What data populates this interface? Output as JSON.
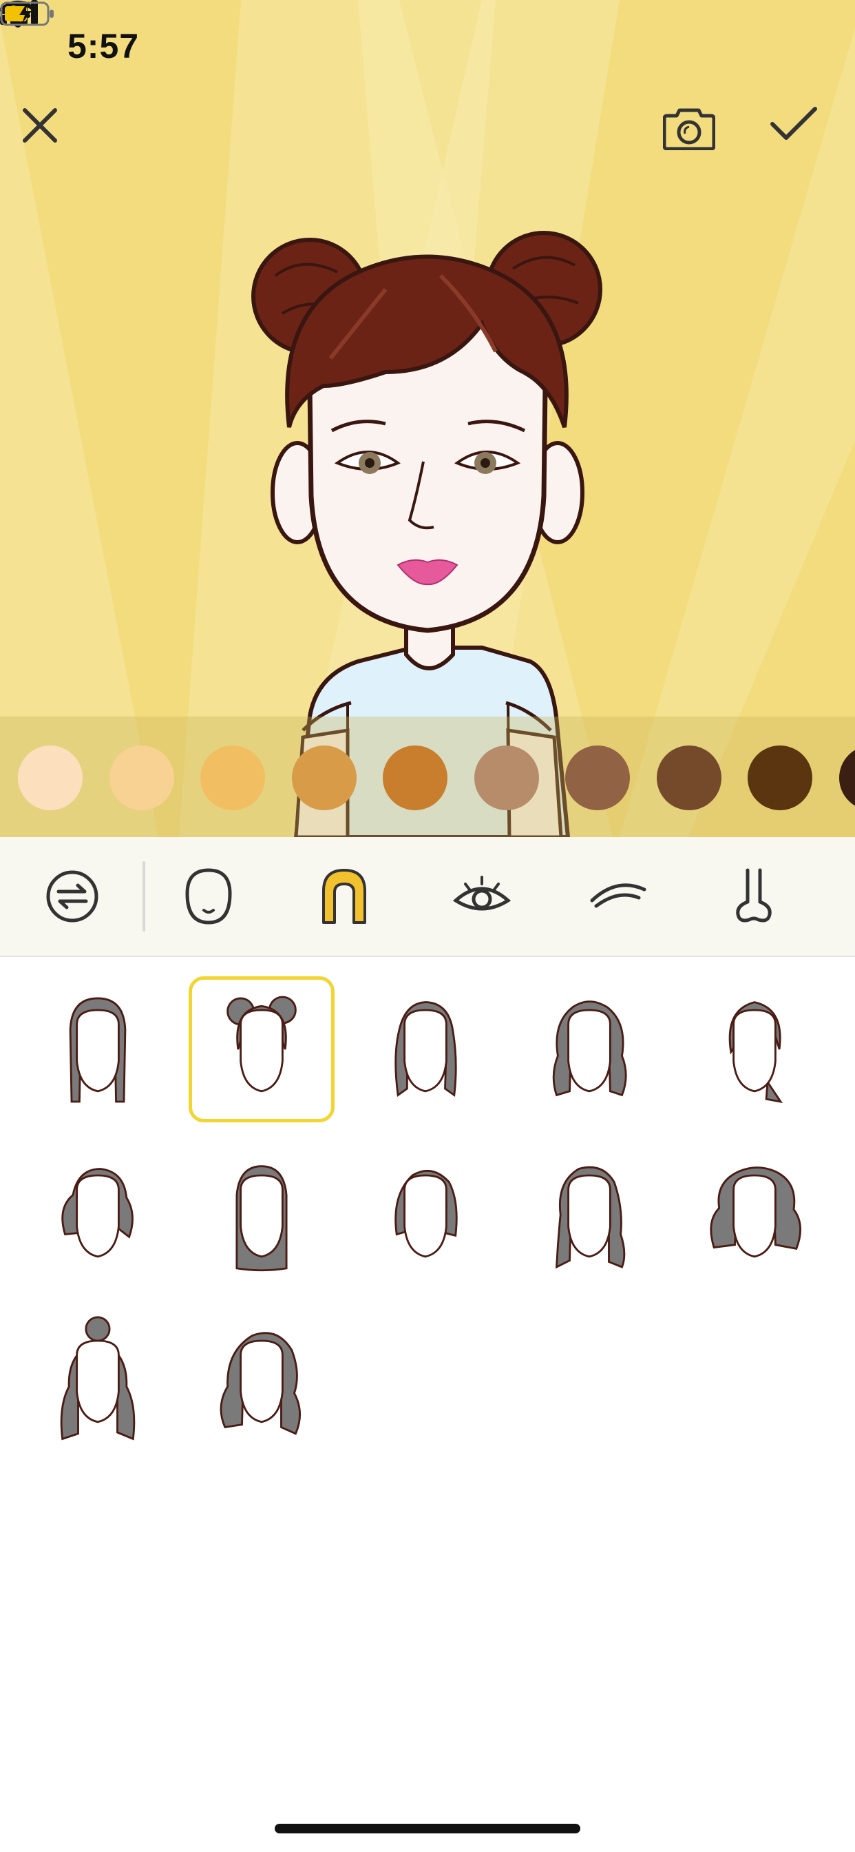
{
  "status_bar": {
    "time": "5:57"
  },
  "icons": {
    "location": "location-arrow-icon",
    "signal": "cellular-signal-icon",
    "wifi": "wifi-icon",
    "battery": "battery-charging-icon",
    "close": "close-icon",
    "camera": "camera-icon",
    "confirm": "checkmark-icon"
  },
  "colors": {
    "stage_background": "#f5e38f",
    "selection_accent": "#f2d531",
    "active_tool": "#f2c12e",
    "hair_thumb": "#7a7a7a",
    "avatar_hair": "#6b2315",
    "avatar_skin": "#fbf3ef",
    "avatar_shirt": "#dff1fb"
  },
  "skin_tones": [
    "#fce0bd",
    "#f8d292",
    "#f1be62",
    "#d89b48",
    "#c87e2c",
    "#b78c6a",
    "#916244",
    "#744a2b",
    "#5a3510",
    "#3a1f12"
  ],
  "toolbar": {
    "tools": [
      {
        "name": "swap-icon",
        "active": false
      },
      {
        "name": "face-shape-icon",
        "active": false
      },
      {
        "name": "hair-icon",
        "active": true
      },
      {
        "name": "eye-icon",
        "active": false
      },
      {
        "name": "eyebrow-icon",
        "active": false
      },
      {
        "name": "nose-icon",
        "active": false
      }
    ]
  },
  "hair_styles": {
    "selected_index": 1,
    "items": [
      "straight-long-hair",
      "double-buns-hair",
      "shoulder-bob-hair",
      "wavy-long-hair",
      "short-side-swept-hair",
      "curly-short-hair",
      "sleek-straight-hair",
      "side-part-bob-hair",
      "layered-wavy-hair",
      "voluminous-curly-hair",
      "top-bun-wavy-hair",
      "long-wavy-hair"
    ]
  }
}
